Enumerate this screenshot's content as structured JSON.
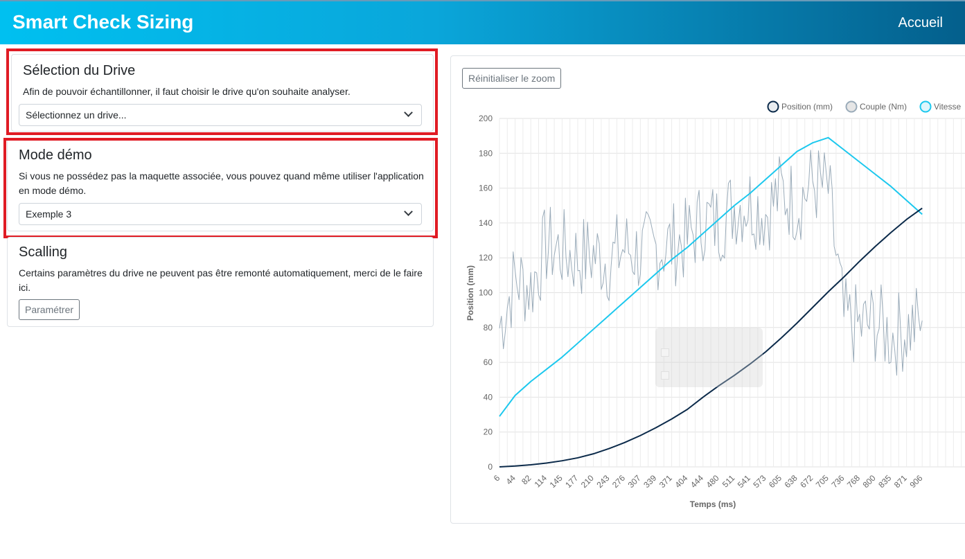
{
  "navbar": {
    "brand": "Smart Check Sizing",
    "home_link": "Accueil"
  },
  "drive_card": {
    "title": "Sélection du Drive",
    "description": "Afin de pouvoir échantillonner, il faut choisir le drive qu'on souhaite analyser.",
    "select_value": "Sélectionnez un drive..."
  },
  "demo_card": {
    "title": "Mode démo",
    "description_line1": "Si vous ne possédez pas la maquette associée, vous pouvez quand même utiliser l'application",
    "description_line2": "en mode démo.",
    "select_value": "Exemple 3"
  },
  "scaling_card": {
    "title": "Scalling",
    "description_line1": "Certains paramètres du drive ne peuvent pas être remonté automatiquement, merci de le faire",
    "description_line2": "ici.",
    "button_label": "Paramétrer"
  },
  "chart_panel": {
    "reset_zoom_label": "Réinitialiser le zoom"
  },
  "colors": {
    "highlight": "#e01b24",
    "position": "#0b2a4a",
    "couple": "#9aabb9",
    "vitesse": "#1cc8ee"
  },
  "chart_data": {
    "type": "line",
    "xlabel": "Temps (ms)",
    "ylabel": "Position (mm)",
    "ylim": [
      0,
      200
    ],
    "yticks": [
      0,
      20,
      40,
      60,
      80,
      100,
      120,
      140,
      160,
      180,
      200
    ],
    "x_tick_labels": [
      "6",
      "44",
      "82",
      "114",
      "145",
      "177",
      "210",
      "243",
      "276",
      "307",
      "339",
      "371",
      "404",
      "444",
      "480",
      "511",
      "541",
      "573",
      "605",
      "638",
      "672",
      "705",
      "736",
      "768",
      "800",
      "835",
      "871",
      "906"
    ],
    "grid": true,
    "legend_position": "top-right",
    "series": [
      {
        "name": "Position (mm)",
        "values": [
          0,
          0.5,
          1.2,
          2.2,
          3.5,
          5.2,
          7.5,
          10.5,
          14,
          18,
          22.5,
          27.5,
          33,
          40,
          46.5,
          52.5,
          59,
          66,
          74,
          82.5,
          91.5,
          100.5,
          109,
          118,
          126.5,
          134.5,
          142,
          148.5
        ]
      },
      {
        "name": "Couple (Nm)",
        "values": [
          80,
          108,
          103,
          127,
          124,
          120,
          122,
          118,
          126,
          122,
          125,
          128,
          130,
          142,
          140,
          150,
          152,
          146,
          158,
          151,
          163,
          159,
          84,
          80,
          83,
          75,
          79,
          84
        ]
      },
      {
        "name": "Vitesse",
        "values": [
          29,
          41,
          49,
          56,
          63,
          71,
          79,
          87,
          95,
          103,
          111,
          119,
          126,
          134,
          142,
          150,
          157,
          165,
          173,
          181,
          186,
          189,
          182,
          175,
          168,
          161,
          153,
          145
        ]
      }
    ]
  }
}
